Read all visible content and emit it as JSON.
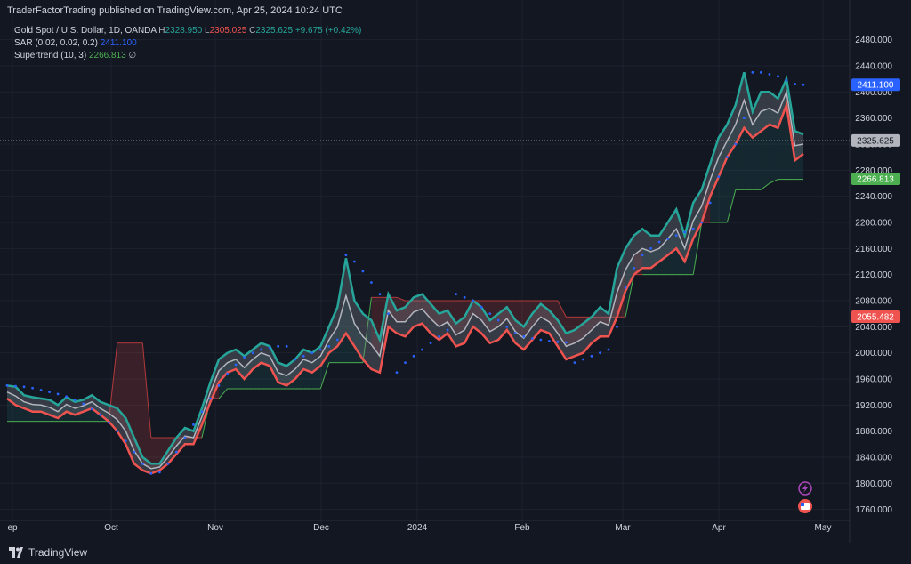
{
  "header": {
    "publisher": "TraderFactorTrading published on TradingView.com, Apr 25, 2024 10:24 UTC"
  },
  "legend": {
    "symbol": "Gold Spot / U.S. Dollar, 1D, OANDA",
    "h_label": "H",
    "h_value": "2328.950",
    "l_label": "L",
    "l_value": "2305.025",
    "c_label": "C",
    "c_value": "2325.625",
    "change": "+9.675 (+0.42%)",
    "sar_label": "SAR (0.02, 0.02, 0.2)",
    "sar_value": "2411.100",
    "st_label": "Supertrend (10, 3)",
    "st_value": "2266.813",
    "st_extra": "∅"
  },
  "footer": {
    "brand": "TradingView"
  },
  "colors": {
    "bg": "#131722",
    "grid": "#1e222d",
    "up": "#26a69a",
    "down": "#ef5350",
    "sar": "#2962ff",
    "supertrend": "#4caf50",
    "price_tag": "#b2b5be"
  },
  "chart_data": {
    "type": "line",
    "yticks": [
      "2480.000",
      "2440.000",
      "2400.000",
      "2360.000",
      "2320.000",
      "2280.000",
      "2240.000",
      "2200.000",
      "2160.000",
      "2120.000",
      "2080.000",
      "2040.000",
      "2000.000",
      "1960.000",
      "1920.000",
      "1880.000",
      "1840.000",
      "1800.000",
      "1760.000"
    ],
    "ylim": [
      1750,
      2500
    ],
    "xticks": [
      "ep",
      "Oct",
      "Nov",
      "Dec",
      "2024",
      "Feb",
      "Mar",
      "Apr",
      "May"
    ],
    "price_tags": [
      {
        "label": "2411.100",
        "value": 2411.1,
        "color": "#2962ff"
      },
      {
        "label": "2325.625",
        "value": 2325.625,
        "color": "#b2b5be"
      },
      {
        "label": "2266.813",
        "value": 2266.813,
        "color": "#4caf50"
      },
      {
        "label": "2055.482",
        "value": 2055.482,
        "color": "#ef5350"
      }
    ],
    "series": [
      {
        "name": "High",
        "values": [
          1950,
          1948,
          1935,
          1932,
          1930,
          1928,
          1920,
          1932,
          1925,
          1928,
          1935,
          1925,
          1920,
          1915,
          1900,
          1870,
          1840,
          1830,
          1830,
          1850,
          1870,
          1885,
          1880,
          1915,
          1955,
          1990,
          2000,
          2005,
          1995,
          2005,
          2015,
          2010,
          1985,
          1980,
          1990,
          2005,
          2000,
          2010,
          2040,
          2070,
          2145,
          2080,
          2060,
          2050,
          2020,
          2090,
          2065,
          2070,
          2085,
          2090,
          2075,
          2060,
          2065,
          2045,
          2055,
          2080,
          2070,
          2050,
          2060,
          2070,
          2050,
          2040,
          2060,
          2075,
          2065,
          2050,
          2030,
          2035,
          2045,
          2055,
          2070,
          2060,
          2130,
          2160,
          2180,
          2190,
          2180,
          2180,
          2200,
          2220,
          2180,
          2230,
          2250,
          2290,
          2330,
          2350,
          2380,
          2430,
          2370,
          2400,
          2400,
          2390,
          2420,
          2340,
          2335
        ]
      },
      {
        "name": "Low",
        "values": [
          1930,
          1920,
          1915,
          1910,
          1910,
          1905,
          1900,
          1910,
          1905,
          1910,
          1915,
          1905,
          1895,
          1880,
          1860,
          1830,
          1820,
          1815,
          1820,
          1830,
          1845,
          1860,
          1860,
          1890,
          1925,
          1955,
          1970,
          1975,
          1960,
          1975,
          1985,
          1980,
          1955,
          1950,
          1960,
          1975,
          1970,
          1980,
          2000,
          2010,
          2030,
          2010,
          1990,
          1975,
          1970,
          2040,
          2030,
          2025,
          2040,
          2045,
          2030,
          2020,
          2030,
          2010,
          2015,
          2040,
          2030,
          2015,
          2020,
          2035,
          2015,
          2005,
          2020,
          2035,
          2030,
          2010,
          1990,
          1995,
          2000,
          2015,
          2025,
          2025,
          2055,
          2095,
          2120,
          2130,
          2130,
          2140,
          2150,
          2160,
          2140,
          2175,
          2200,
          2240,
          2270,
          2300,
          2320,
          2345,
          2330,
          2340,
          2350,
          2345,
          2380,
          2295,
          2305
        ]
      },
      {
        "name": "SAR",
        "values": [
          1950,
          1949,
          1948,
          1946,
          1943,
          1940,
          1937,
          1933,
          1928,
          1922,
          1914,
          1905,
          1893,
          1880,
          1865,
          1848,
          1830,
          1815,
          1817,
          1830,
          1848,
          1870,
          1890,
          1910,
          1930,
          1950,
          1968,
          1982,
          1993,
          2000,
          2005,
          2008,
          2010,
          2010,
          1990,
          1995,
          2000,
          2005,
          2010,
          2020,
          2150,
          2140,
          2125,
          2108,
          2090,
          2060,
          1970,
          1985,
          1995,
          2005,
          2015,
          2025,
          2035,
          2090,
          2085,
          2080,
          2070,
          2060,
          2050,
          2040,
          2030,
          2025,
          2022,
          2020,
          2018,
          2017,
          2016,
          1985,
          1990,
          1995,
          2000,
          2005,
          2040,
          2100,
          2130,
          2150,
          2160,
          2170,
          2175,
          2180,
          2185,
          2190,
          2200,
          2230,
          2270,
          2300,
          2320,
          2360,
          2430,
          2430,
          2427,
          2424,
          2418,
          2412,
          2411
        ]
      },
      {
        "name": "Supertrend",
        "values": [
          1895,
          1895,
          1895,
          1895,
          1895,
          1895,
          1895,
          1895,
          1895,
          1895,
          1895,
          1895,
          1895,
          2015,
          2015,
          2015,
          2015,
          1870,
          1870,
          1870,
          1870,
          1870,
          1870,
          1870,
          1930,
          1930,
          1945,
          1945,
          1945,
          1945,
          1945,
          1945,
          1945,
          1945,
          1945,
          1945,
          1945,
          1945,
          1985,
          1985,
          1985,
          1985,
          1985,
          2085,
          2085,
          2085,
          2085,
          2080,
          2080,
          2080,
          2080,
          2080,
          2080,
          2080,
          2080,
          2080,
          2080,
          2080,
          2080,
          2080,
          2080,
          2080,
          2080,
          2080,
          2080,
          2080,
          2055,
          2055,
          2055,
          2055,
          2055,
          2055,
          2055,
          2055,
          2120,
          2120,
          2120,
          2120,
          2120,
          2120,
          2120,
          2120,
          2200,
          2200,
          2200,
          2200,
          2250,
          2250,
          2250,
          2250,
          2260,
          2266,
          2266,
          2266,
          2266
        ]
      }
    ]
  }
}
